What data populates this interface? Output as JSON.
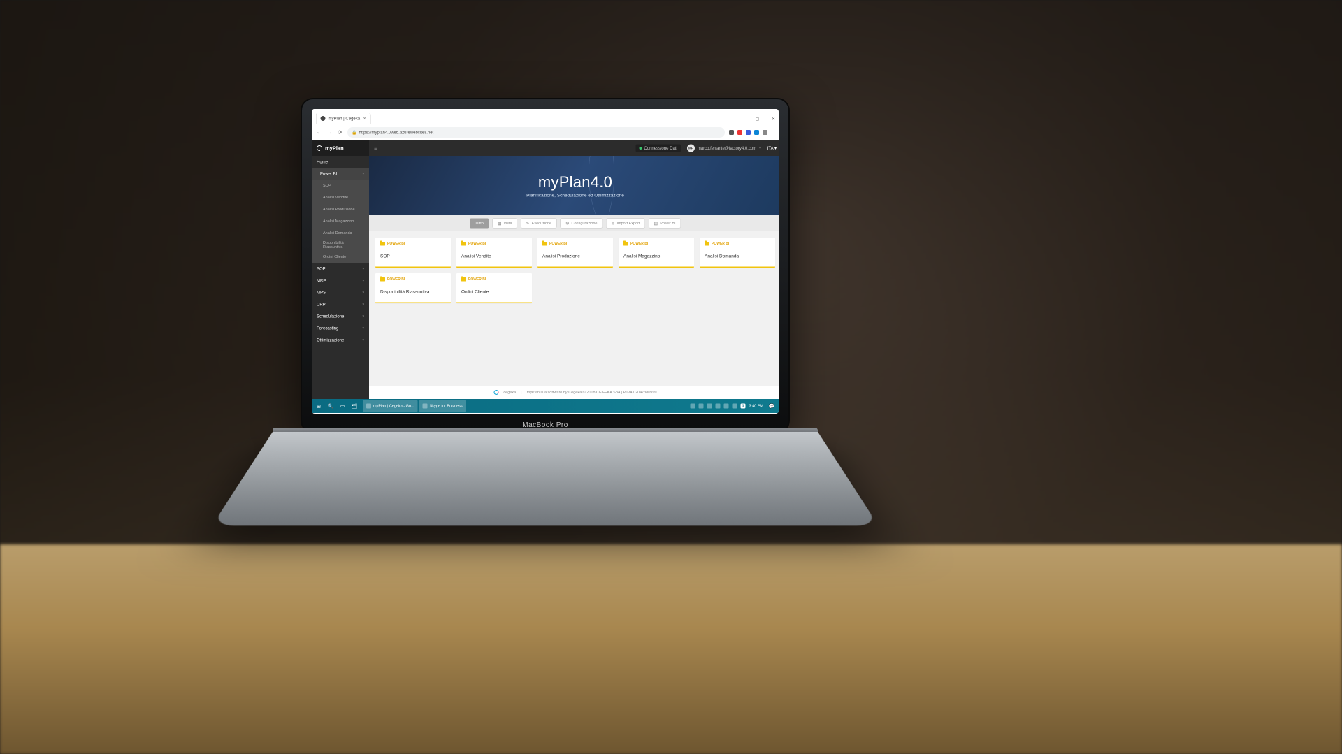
{
  "browser": {
    "tab_title": "myPlan | Cegeka",
    "url": "https://myplan4.0web.azurewebsites.net",
    "window_controls": {
      "min": "—",
      "max": "▢",
      "close": "✕"
    }
  },
  "sidebar": {
    "brand": "myPlan",
    "items": [
      {
        "label": "Home",
        "level": 1,
        "expandable": false
      },
      {
        "label": "Power BI",
        "level": 2,
        "expandable": true,
        "active": true
      },
      {
        "label": "SOP",
        "level": 3
      },
      {
        "label": "Analisi Vendite",
        "level": 3
      },
      {
        "label": "Analisi Produzione",
        "level": 3
      },
      {
        "label": "Analisi Magazzino",
        "level": 3
      },
      {
        "label": "Analisi Domanda",
        "level": 3
      },
      {
        "label": "Disponibilità Riassuntiva",
        "level": 3
      },
      {
        "label": "Ordini Cliente",
        "level": 3
      },
      {
        "label": "SOP",
        "level": 1,
        "expandable": true
      },
      {
        "label": "MRP",
        "level": 1,
        "expandable": true
      },
      {
        "label": "MPS",
        "level": 1,
        "expandable": true
      },
      {
        "label": "CRP",
        "level": 1,
        "expandable": true
      },
      {
        "label": "Schedulazione",
        "level": 1,
        "expandable": true
      },
      {
        "label": "Forecasting",
        "level": 1,
        "expandable": true
      },
      {
        "label": "Ottimizzazione",
        "level": 1,
        "expandable": true
      }
    ]
  },
  "topbar": {
    "connection": "Connessione Dati",
    "user_initials": "MF",
    "user_email": "marco.ferrante@factory4.0.com",
    "language": "ITA"
  },
  "hero": {
    "title": "myPlan4.0",
    "subtitle": "Pianificazione, Schedulazione ed Ottimizzazione"
  },
  "filters": [
    {
      "label": "Tutto",
      "active": true
    },
    {
      "label": "Vista",
      "icon": "▦"
    },
    {
      "label": "Esecuzione",
      "icon": "✎"
    },
    {
      "label": "Configurazione",
      "icon": "⚙"
    },
    {
      "label": "Import Export",
      "icon": "⇅"
    },
    {
      "label": "Power BI",
      "icon": "▤"
    }
  ],
  "card_tag": "POWER BI",
  "cards": [
    {
      "name": "SOP"
    },
    {
      "name": "Analisi Vendite"
    },
    {
      "name": "Analisi Produzione"
    },
    {
      "name": "Analisi Magazzino"
    },
    {
      "name": "Analisi Domanda"
    },
    {
      "name": "Disponibilità Riassuntiva"
    },
    {
      "name": "Ordini Cliente"
    }
  ],
  "footer": {
    "brand": "cegeka",
    "text": "myPlan is a software by Cegeka © 2018 CEGEKA SpA | P.IVA 02047380999"
  },
  "taskbar": {
    "tasks": [
      {
        "label": "myPlan | Cegeka - Go..."
      },
      {
        "label": "Skype for Business"
      }
    ],
    "time": "3:40 PM",
    "notif": "1"
  },
  "laptop_label": "MacBook Pro"
}
